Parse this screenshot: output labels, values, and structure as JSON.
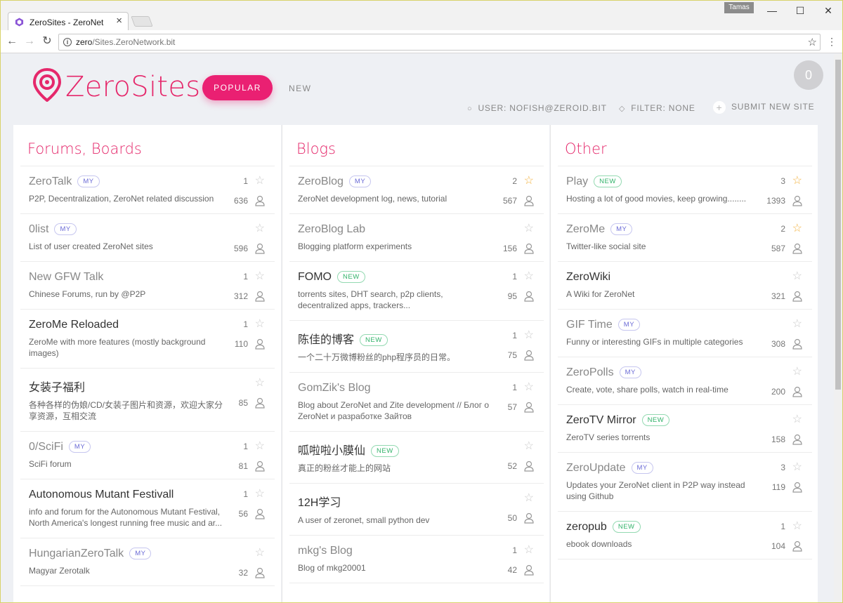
{
  "browser": {
    "tab_title": "ZeroSites - ZeroNet",
    "tab_close": "×",
    "user_badge": "Tamas",
    "url_host": "zero",
    "url_path": "/Sites.ZeroNetwork.bit",
    "win_minimize": "—",
    "win_maximize": "☐",
    "win_close": "✕"
  },
  "header": {
    "brand": "ZeroSites",
    "popular_label": "POPULAR",
    "new_label": "NEW",
    "counter": "0",
    "user_label": "USER: NOFISH@ZEROID.BIT",
    "filter_label": "FILTER: NONE",
    "submit_label": "SUBMIT NEW SITE"
  },
  "columns": [
    {
      "title": "Forums, Boards",
      "sites": [
        {
          "name": "ZeroTalk",
          "badge": "MY",
          "desc": "P2P, Decentralization, ZeroNet related discussion",
          "favs": "1",
          "peers": "636",
          "starred": false,
          "dim": true
        },
        {
          "name": "0list",
          "badge": "MY",
          "desc": "List of user created ZeroNet sites",
          "favs": "",
          "peers": "596",
          "starred": false,
          "dim": true
        },
        {
          "name": "New GFW Talk",
          "badge": "",
          "desc": "Chinese Forums, run by @P2P",
          "favs": "1",
          "peers": "312",
          "starred": false,
          "dim": true
        },
        {
          "name": "ZeroMe Reloaded",
          "badge": "",
          "desc": "ZeroMe with more features (mostly background images)",
          "favs": "1",
          "peers": "110",
          "starred": false,
          "dim": false
        },
        {
          "name": "女装子福利",
          "badge": "",
          "desc": "各种各样的伪娘/CD/女装子图片和资源，欢迎大家分享资源，互相交流",
          "favs": "",
          "peers": "85",
          "starred": false,
          "dim": false
        },
        {
          "name": "0/SciFi",
          "badge": "MY",
          "desc": "SciFi forum",
          "favs": "1",
          "peers": "81",
          "starred": false,
          "dim": true
        },
        {
          "name": "Autonomous Mutant Festivall",
          "badge": "",
          "desc": "info and forum for the Autonomous Mutant Festival, North America's longest running free music and ar...",
          "favs": "1",
          "peers": "56",
          "starred": false,
          "dim": false
        },
        {
          "name": "HungarianZeroTalk",
          "badge": "MY",
          "desc": "Magyar Zerotalk",
          "favs": "",
          "peers": "32",
          "starred": false,
          "dim": true
        }
      ]
    },
    {
      "title": "Blogs",
      "sites": [
        {
          "name": "ZeroBlog",
          "badge": "MY",
          "desc": "ZeroNet development log, news, tutorial",
          "favs": "2",
          "peers": "567",
          "starred": true,
          "dim": true
        },
        {
          "name": "ZeroBlog Lab",
          "badge": "",
          "desc": "Blogging platform experiments",
          "favs": "",
          "peers": "156",
          "starred": false,
          "dim": true
        },
        {
          "name": "FOMO",
          "badge": "NEW",
          "desc": "torrents sites, DHT search, p2p clients, decentralized apps, trackers...",
          "favs": "1",
          "peers": "95",
          "starred": false,
          "dim": false
        },
        {
          "name": "陈佳的博客",
          "badge": "NEW",
          "desc": "一个二十万微博粉丝的php程序员的日常。",
          "favs": "1",
          "peers": "75",
          "starred": false,
          "dim": false
        },
        {
          "name": "GomZik's Blog",
          "badge": "",
          "desc": "Blog about ZeroNet and Zite development // Блог о ZeroNet и разработке Зайтов",
          "favs": "1",
          "peers": "57",
          "starred": false,
          "dim": true
        },
        {
          "name": "呱啦啦小膜仙",
          "badge": "NEW",
          "desc": "真正的粉丝才能上的网站",
          "favs": "",
          "peers": "52",
          "starred": false,
          "dim": false
        },
        {
          "name": "12H学习",
          "badge": "",
          "desc": "A user of zeronet, small python dev",
          "favs": "",
          "peers": "50",
          "starred": false,
          "dim": false
        },
        {
          "name": "mkg's Blog",
          "badge": "",
          "desc": "Blog of mkg20001",
          "favs": "1",
          "peers": "42",
          "starred": false,
          "dim": true
        }
      ]
    },
    {
      "title": "Other",
      "sites": [
        {
          "name": "Play",
          "badge": "NEW",
          "desc": "Hosting a lot of good movies, keep growing........",
          "favs": "3",
          "peers": "1393",
          "starred": true,
          "dim": true
        },
        {
          "name": "ZeroMe",
          "badge": "MY",
          "desc": "Twitter-like social site",
          "favs": "2",
          "peers": "587",
          "starred": true,
          "dim": true
        },
        {
          "name": "ZeroWiki",
          "badge": "",
          "desc": "A Wiki for ZeroNet",
          "favs": "",
          "peers": "321",
          "starred": false,
          "dim": false
        },
        {
          "name": "GIF Time",
          "badge": "MY",
          "desc": "Funny or interesting GIFs in multiple categories",
          "favs": "",
          "peers": "308",
          "starred": false,
          "dim": true
        },
        {
          "name": "ZeroPolls",
          "badge": "MY",
          "desc": "Create, vote, share polls, watch in real-time",
          "favs": "",
          "peers": "200",
          "starred": false,
          "dim": true
        },
        {
          "name": "ZeroTV Mirror",
          "badge": "NEW",
          "desc": "ZeroTV series torrents",
          "favs": "",
          "peers": "158",
          "starred": false,
          "dim": false
        },
        {
          "name": "ZeroUpdate",
          "badge": "MY",
          "desc": "Updates your ZeroNet client in P2P way instead using Github",
          "favs": "3",
          "peers": "119",
          "starred": false,
          "dim": true
        },
        {
          "name": "zeropub",
          "badge": "NEW",
          "desc": "ebook downloads",
          "favs": "1",
          "peers": "104",
          "starred": false,
          "dim": false
        }
      ]
    }
  ],
  "colors": {
    "accent": "#e5286b",
    "star_on": "#f2b342",
    "badge_my": "#6b6bd6",
    "badge_new": "#32b36a"
  }
}
